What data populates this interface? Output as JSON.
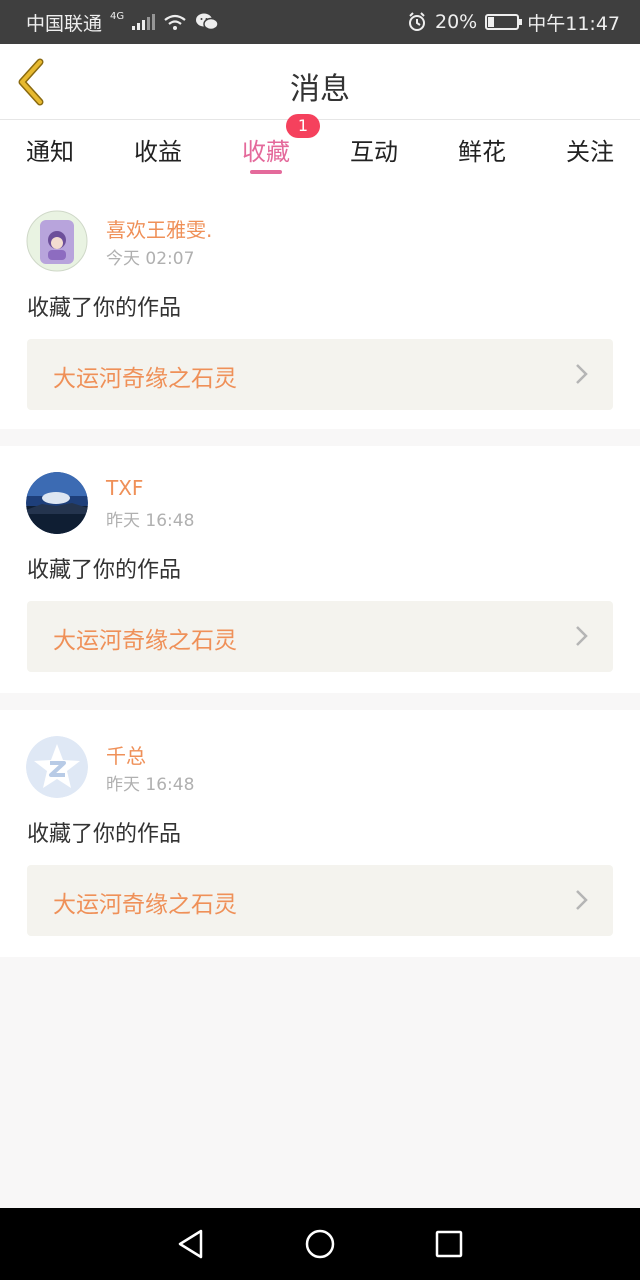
{
  "status_bar": {
    "carrier": "中国联通",
    "network": "4G",
    "battery": "20%",
    "battery_level": 0.2,
    "time": "中午11:47"
  },
  "header": {
    "title": "消息"
  },
  "tabs": [
    {
      "label": "通知"
    },
    {
      "label": "收益"
    },
    {
      "label": "收藏",
      "badge": "1",
      "active": true
    },
    {
      "label": "互动"
    },
    {
      "label": "鲜花"
    },
    {
      "label": "关注"
    }
  ],
  "messages": [
    {
      "user": "喜欢王雅雯.",
      "time": "今天 02:07",
      "action": "收藏了你的作品",
      "work": "大运河奇缘之石灵"
    },
    {
      "user": "TXF",
      "time": "昨天 16:48",
      "action": "收藏了你的作品",
      "work": "大运河奇缘之石灵"
    },
    {
      "user": "千总",
      "time": "昨天 16:48",
      "action": "收藏了你的作品",
      "work": "大运河奇缘之石灵"
    }
  ],
  "colors": {
    "accent_pink": "#e46a9b",
    "username_orange": "#ef9058",
    "badge_red": "#f5415d",
    "back_arrow": "#e7b92f"
  }
}
